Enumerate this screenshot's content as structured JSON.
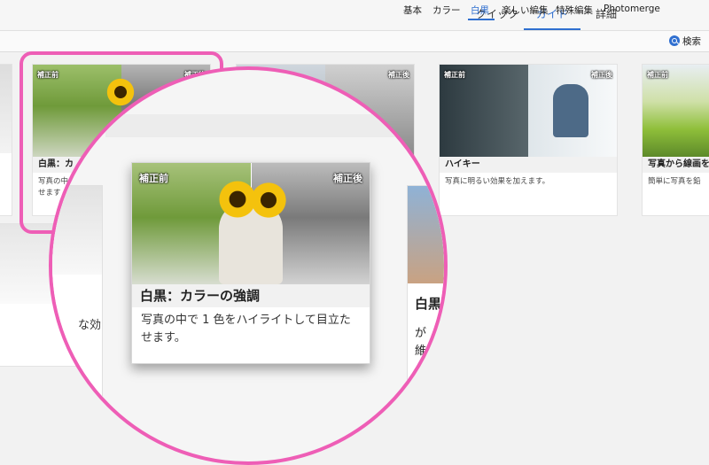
{
  "mode_tabs": [
    "クイック",
    "ガイド",
    "詳細"
  ],
  "active_mode": "ガイド",
  "sub_tabs": [
    "基本",
    "カラー",
    "白黒",
    "楽しい編集",
    "特殊編集",
    "Photomerge"
  ],
  "active_sub_tab": "白黒",
  "search": {
    "label": "検索"
  },
  "tags": {
    "before": "補正前",
    "after": "補正後"
  },
  "cards": {
    "color_pop": {
      "title": "白黒：カラーの強調",
      "desc_line1": "写真の中で 1 色をハイライトして目立た",
      "desc_line2": "せます。",
      "title_small": "白黒：カ",
      "desc_small_1": "写真の中",
      "desc_small_2": "せます"
    },
    "high_key": {
      "title": "ハイキー",
      "desc": "写真に明るい効果を加えます。"
    },
    "line_drawing": {
      "title": "写真から線画を",
      "desc": "簡単に写真を鉛"
    },
    "partial_left": {
      "desc": "な効"
    },
    "partial_right": {
      "title": "白黒",
      "desc1": "が",
      "desc2": "維"
    }
  },
  "colors": {
    "accent": "#2f6fd0",
    "highlight": "#ee5eb6"
  }
}
